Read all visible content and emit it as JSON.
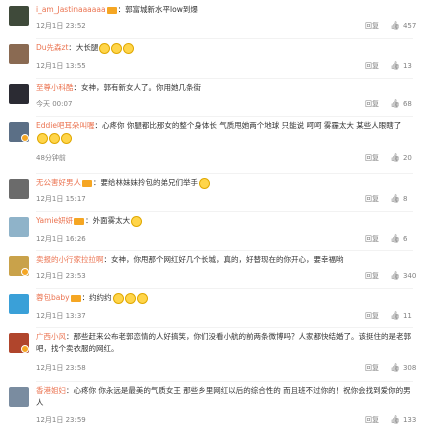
{
  "comments": [
    {
      "user": "i_am_Jastinaaaaaa",
      "sep": "：",
      "text": "郭富城新水平low到爆",
      "time": "12月1日 23:52",
      "reply": "回复",
      "likes": "457",
      "avatar_color": "#3f4a3a",
      "vip": true,
      "emoji": 0
    },
    {
      "user": "Du先森zt",
      "sep": "：",
      "text": "大长腿",
      "time": "12月1日 13:55",
      "reply": "回复",
      "likes": "13",
      "avatar_color": "#8a6a52",
      "vip": false,
      "emoji": 3
    },
    {
      "user": "至尊小科酷",
      "sep": "：",
      "text": "女神，郭有新女人了。你用她几条街",
      "time": "今天 00:07",
      "reply": "回复",
      "likes": "68",
      "avatar_color": "#2b2b33",
      "vip": false,
      "emoji": 0
    },
    {
      "user": "Eddie吧耳朵叫喔",
      "sep": "：",
      "text": "心疼你 你腿都比那女的整个身体长 气质甩她两个地球 只能说 呵呵 雾霾太大 某些人眼瞎了",
      "time": "48分钟前",
      "reply": "回复",
      "likes": "20",
      "avatar_color": "#5b6f86",
      "vip": false,
      "emoji": 3
    },
    {
      "user": "无公害好男人",
      "sep": "：",
      "text": "要给林妹妹拎包的弟兄们举手",
      "time": "12月1日 15:17",
      "reply": "回复",
      "likes": "8",
      "avatar_color": "#6b6b6b",
      "vip": true,
      "emoji": 1
    },
    {
      "user": "Yamie妍妍",
      "sep": "：",
      "text": "外面雾太大",
      "time": "12月1日 16:26",
      "reply": "回复",
      "likes": "6",
      "avatar_color": "#8fb3c9",
      "vip": true,
      "emoji": 1
    },
    {
      "user": "卖报的小行家拉拉啊",
      "sep": "：",
      "text": "女神，你甩那个网红好几个长城，真的，好替现在的你开心，要幸福哟",
      "time": "12月1日 23:53",
      "reply": "回复",
      "likes": "340",
      "avatar_color": "#c9a24a",
      "vip": false,
      "emoji": 0
    },
    {
      "user": "蓉包baby",
      "sep": "：",
      "text": "约约约",
      "time": "12月1日 13:37",
      "reply": "回复",
      "likes": "11",
      "avatar_color": "#3aa0d8",
      "vip": true,
      "emoji": 3
    },
    {
      "user": "广西小风",
      "sep": "：",
      "text": "那些赶来公布老郭恋情的人好搞笑，你们没看小航的前两条微博吗？人家都快结婚了。该挺住的是老郭吧，找个卖衣服的网红。",
      "time": "12月1日 23:58",
      "reply": "回复",
      "likes": "308",
      "avatar_color": "#b0452c",
      "vip": false,
      "emoji": 0
    },
    {
      "user": "香港姐妇",
      "sep": "：",
      "text": "心疼你 你永远是最美的气质女王 那些乡里网红以后的综合性的 而且班不过你的！祝你会找到爱你的男人",
      "time": "12月1日 23:59",
      "reply": "回复",
      "likes": "133",
      "avatar_color": "#7a8ca0",
      "vip": false,
      "emoji": 0
    }
  ]
}
